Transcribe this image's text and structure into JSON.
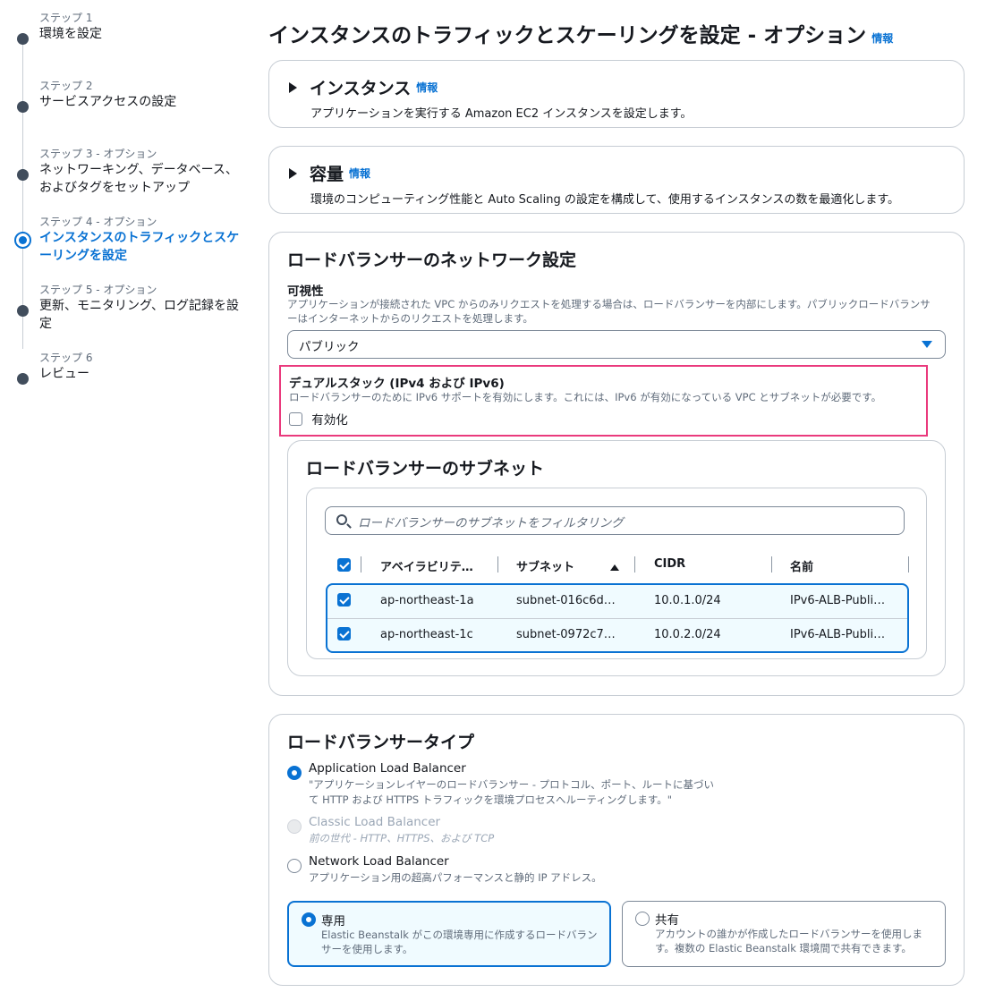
{
  "steps": [
    {
      "num": "ステップ 1",
      "title": "環境を設定"
    },
    {
      "num": "ステップ 2",
      "title": "サービスアクセスの設定"
    },
    {
      "num": "ステップ 3 - オプション",
      "title": "ネットワーキング、データベース、およびタグをセットアップ"
    },
    {
      "num": "ステップ 4 - オプション",
      "title": "インスタンスのトラフィックとスケーリングを設定",
      "active": true
    },
    {
      "num": "ステップ 5 - オプション",
      "title": "更新、モニタリング、ログ記録を設定"
    },
    {
      "num": "ステップ 6",
      "title": "レビュー"
    }
  ],
  "page": {
    "title": "インスタンスのトラフィックとスケーリングを設定 - オプション",
    "info": "情報"
  },
  "instances": {
    "title": "インスタンス",
    "info": "情報",
    "description": "アプリケーションを実行する Amazon EC2 インスタンスを設定します。"
  },
  "capacity": {
    "title": "容量",
    "info": "情報",
    "description": "環境のコンピューティング性能と Auto Scaling の設定を構成して、使用するインスタンスの数を最適化します。"
  },
  "lb_network": {
    "title": "ロードバランサーのネットワーク設定",
    "visibility_label": "可視性",
    "visibility_desc": "アプリケーションが接続された VPC からのみリクエストを処理する場合は、ロードバランサーを内部にします。パブリックロードバランサーはインターネットからのリクエストを処理します。",
    "visibility_value": "パブリック",
    "dualstack_label": "デュアルスタック (IPv4 および IPv6)",
    "dualstack_desc": "ロードバランサーのために IPv6 サポートを有効にします。これには、IPv6 が有効になっている VPC とサブネットが必要です。",
    "dualstack_checkbox": "有効化"
  },
  "subnets": {
    "title": "ロードバランサーのサブネット",
    "search_placeholder": "ロードバランサーのサブネットをフィルタリング",
    "columns": [
      "アベイラビリテ…",
      "サブネット",
      "CIDR",
      "名前"
    ],
    "rows": [
      {
        "az": "ap-northeast-1a",
        "subnet": "subnet-016c6d…",
        "cidr": "10.0.1.0/24",
        "name": "IPv6-ALB-Publi…"
      },
      {
        "az": "ap-northeast-1c",
        "subnet": "subnet-0972c7…",
        "cidr": "10.0.2.0/24",
        "name": "IPv6-ALB-Publi…"
      }
    ]
  },
  "lb_type": {
    "title": "ロードバランサータイプ",
    "options": [
      {
        "label": "Application Load Balancer",
        "desc": "\"アプリケーションレイヤーのロードバランサー - プロトコル、ポート、ルートに基づいて HTTP および HTTPS トラフィックを環境プロセスへルーティングします。\"",
        "selected": true
      },
      {
        "label": "Classic Load Balancer",
        "desc": "前の世代 - HTTP、HTTPS、および TCP",
        "disabled": true
      },
      {
        "label": "Network Load Balancer",
        "desc": "アプリケーション用の超高パフォーマンスと静的 IP アドレス。"
      }
    ],
    "tiles": [
      {
        "label": "専用",
        "desc": "Elastic Beanstalk がこの環境専用に作成するロードバランサーを使用します。",
        "selected": true
      },
      {
        "label": "共有",
        "desc": "アカウントの誰かが作成したロードバランサーを使用します。複数の Elastic Beanstalk 環境間で共有できます。"
      }
    ]
  },
  "colors": {
    "accent": "#0972d3",
    "highlight": "#ea3a7d",
    "text": "#16191f",
    "muted": "#5f6b7a"
  }
}
